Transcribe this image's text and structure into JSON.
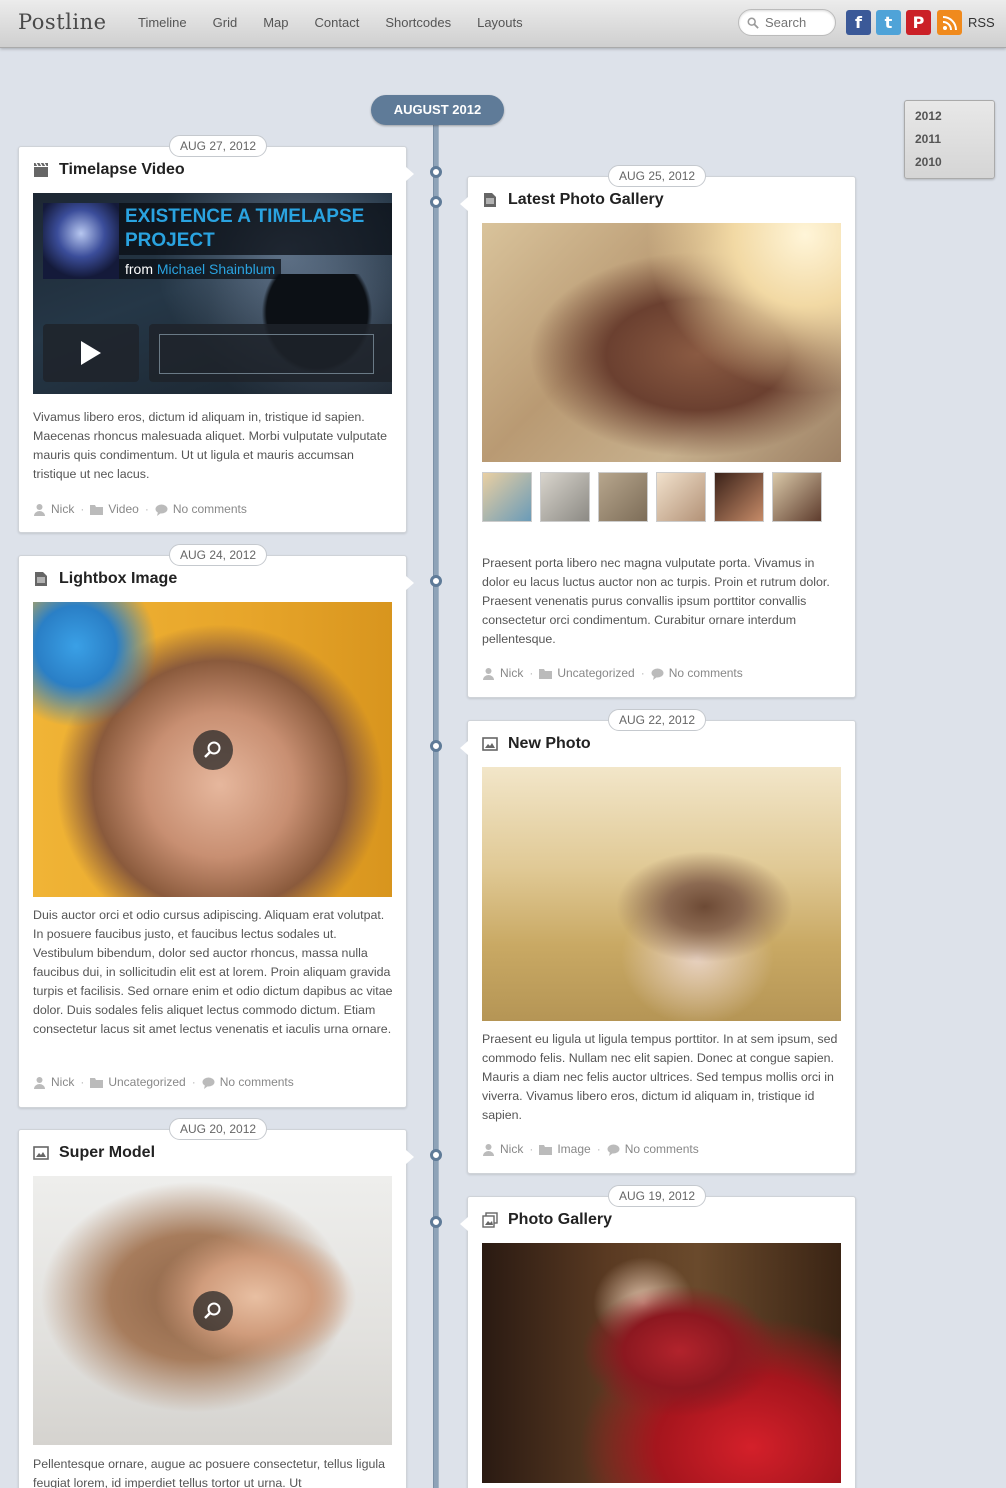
{
  "header": {
    "logo": "Postline",
    "nav": [
      "Timeline",
      "Grid",
      "Map",
      "Contact",
      "Shortcodes",
      "Layouts"
    ],
    "search_placeholder": "Search",
    "social": {
      "facebook": "f",
      "twitter": "t",
      "pinterest": "P",
      "rss_label": "RSS"
    }
  },
  "timeline": {
    "month": "AUGUST 2012",
    "years": [
      "2012",
      "2011",
      "2010"
    ]
  },
  "posts": [
    {
      "date": "AUG 27, 2012",
      "title": "Timelapse Video",
      "icon": "clapperboard-icon",
      "video": {
        "title": "EXISTENCE A TIMELAPSE PROJECT",
        "from": "from",
        "author": "Michael Shainblum"
      },
      "excerpt": "Vivamus libero eros, dictum id aliquam in, tristique id sapien. Maecenas rhoncus malesuada aliquet. Morbi vulputate vulputate mauris quis condimentum. Ut ut ligula et mauris accumsan tristique ut nec lacus.",
      "author": "Nick",
      "category": "Video",
      "comments": "No comments"
    },
    {
      "date": "AUG 25, 2012",
      "title": "Latest Photo Gallery",
      "icon": "document-icon",
      "excerpt": "Praesent porta libero nec magna vulputate porta. Vivamus in dolor eu lacus luctus auctor non ac turpis. Proin et rutrum dolor. Praesent venenatis purus convallis ipsum porttitor convallis consectetur orci condimentum. Curabitur ornare interdum pellentesque.",
      "author": "Nick",
      "category": "Uncategorized",
      "comments": "No comments"
    },
    {
      "date": "AUG 24, 2012",
      "title": "Lightbox Image",
      "icon": "document-icon",
      "excerpt": "Duis auctor orci et odio cursus adipiscing. Aliquam erat volutpat. In posuere faucibus justo, et faucibus lectus sodales ut. Vestibulum bibendum, dolor sed auctor rhoncus, massa nulla faucibus dui, in sollicitudin elit est at lorem. Proin aliquam gravida turpis et facilisis. Sed ornare enim et odio dictum dapibus ac vitae dolor. Duis sodales felis aliquet lectus commodo dictum. Etiam consectetur lacus sit amet lectus venenatis et iaculis urna ornare.",
      "author": "Nick",
      "category": "Uncategorized",
      "comments": "No comments"
    },
    {
      "date": "AUG 22, 2012",
      "title": "New Photo",
      "icon": "image-icon",
      "excerpt": "Praesent eu ligula ut ligula tempus porttitor. In at sem ipsum, sed commodo felis. Nullam nec elit sapien. Donec at congue sapien. Mauris a diam nec felis auctor ultrices. Sed tempus mollis orci in viverra. Vivamus libero eros, dictum id aliquam in, tristique id sapien.",
      "author": "Nick",
      "category": "Image",
      "comments": "No comments"
    },
    {
      "date": "AUG 20, 2012",
      "title": "Super Model",
      "icon": "image-icon",
      "excerpt": "Pellentesque ornare, augue ac posuere consectetur, tellus ligula feugiat lorem, id imperdiet tellus tortor ut urna. Ut"
    },
    {
      "date": "AUG 19, 2012",
      "title": "Photo Gallery",
      "icon": "gallery-icon"
    }
  ],
  "colors": {
    "timeline": "#5f7b98",
    "link": "#2aa3e0",
    "background": "#dde2ea"
  }
}
